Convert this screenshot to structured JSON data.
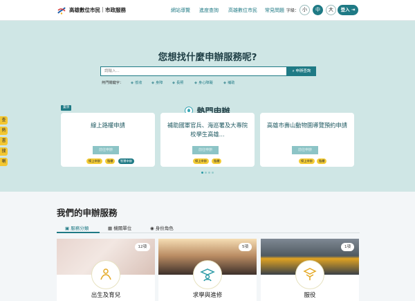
{
  "header": {
    "brand": "高雄數位市民",
    "brand_sub": "市政服務",
    "nav": [
      "網站導覽",
      "進度查詢",
      "高雄數位市民",
      "常見問題"
    ],
    "font_label": "字級：",
    "font_sizes": [
      "小",
      "中",
      "大"
    ],
    "login": "登入"
  },
  "hero": {
    "title": "您想找什麼申辦服務呢?",
    "search_placeholder": "請輸入...",
    "search_button": "申辦查詢",
    "hot_label": "熱門關鍵字：",
    "tags": [
      "低收",
      "身障",
      "長照",
      "身心障礙",
      "補助"
    ]
  },
  "hot": {
    "title": "熱門申辦",
    "pin": "置頂",
    "cards": [
      {
        "title": "線上路權申請",
        "button": "前往申辦",
        "badges": [
          "線上申辦",
          "臨櫃",
          "智慧申辦"
        ]
      },
      {
        "title": "補助國軍官兵、海巡署及大專院校學生高雄...",
        "button": "前往申辦",
        "badges": [
          "線上申辦",
          "臨櫃"
        ]
      },
      {
        "title": "高雄市壽山動物園導覽預約申請",
        "button": "前往申辦",
        "badges": [
          "線上申辦",
          "臨櫃"
        ]
      }
    ]
  },
  "side": [
    "查",
    "熱",
    "書",
    "搜",
    "喇"
  ],
  "services": {
    "title": "我們的申辦服務",
    "tabs": [
      "服務分類",
      "機關單位",
      "身份角色"
    ],
    "items": [
      {
        "name": "出生及育兒",
        "count": "12項"
      },
      {
        "name": "求學與進修",
        "count": "5項"
      },
      {
        "name": "服役",
        "count": "1項"
      }
    ]
  }
}
